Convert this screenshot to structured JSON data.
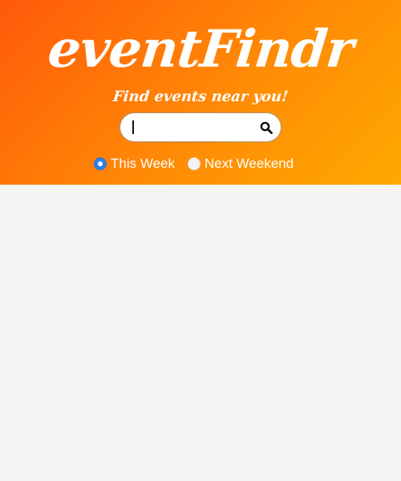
{
  "header": {
    "logo_text": "eventFindr",
    "tagline": "Find events near you!"
  },
  "search": {
    "value": "",
    "icon": "search-icon"
  },
  "filters": {
    "options": [
      {
        "label": "This Week",
        "checked": true
      },
      {
        "label": "Next Weekend",
        "checked": false
      }
    ]
  },
  "colors": {
    "gradient_start": "#ff5a0a",
    "gradient_end": "#ffa900",
    "radio_selected": "#2f7fe8",
    "background": "#f5f5f5"
  }
}
